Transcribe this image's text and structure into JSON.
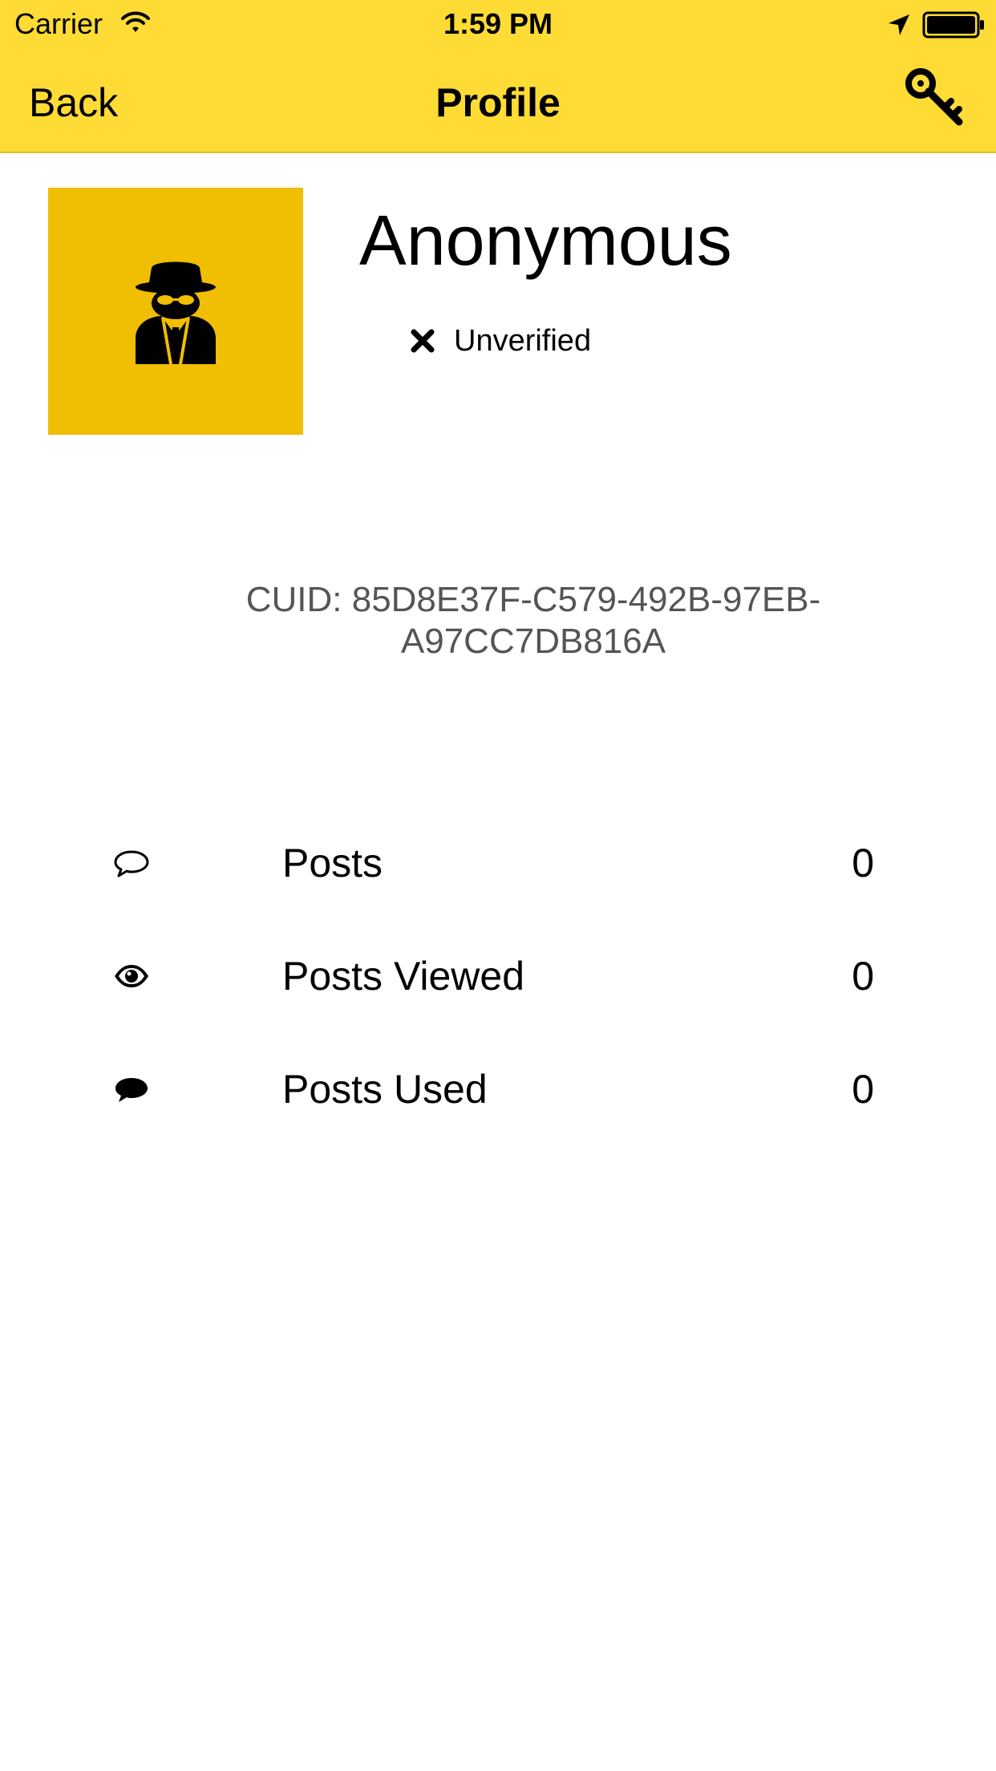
{
  "status_bar": {
    "carrier": "Carrier",
    "time": "1:59 PM",
    "icons": [
      "wifi-icon",
      "location-arrow-icon",
      "battery-icon"
    ]
  },
  "nav": {
    "back_label": "Back",
    "title": "Profile",
    "right_icon": "key-icon"
  },
  "colors": {
    "nav_background": "#fedb35",
    "avatar_background": "#f0be02",
    "cuid_text": "#555555"
  },
  "profile": {
    "avatar_icon": "spy-icon",
    "name": "Anonymous",
    "verification_icon": "x-icon",
    "verification_status": "Unverified",
    "cuid_text": "CUID: 85D8E37F-C579-492B-97EB-A97CC7DB816A"
  },
  "stats": [
    {
      "icon": "comment-outline-icon",
      "label": "Posts",
      "value": "0"
    },
    {
      "icon": "eye-icon",
      "label": "Posts Viewed",
      "value": "0"
    },
    {
      "icon": "comment-filled-icon",
      "label": "Posts Used",
      "value": "0"
    }
  ]
}
